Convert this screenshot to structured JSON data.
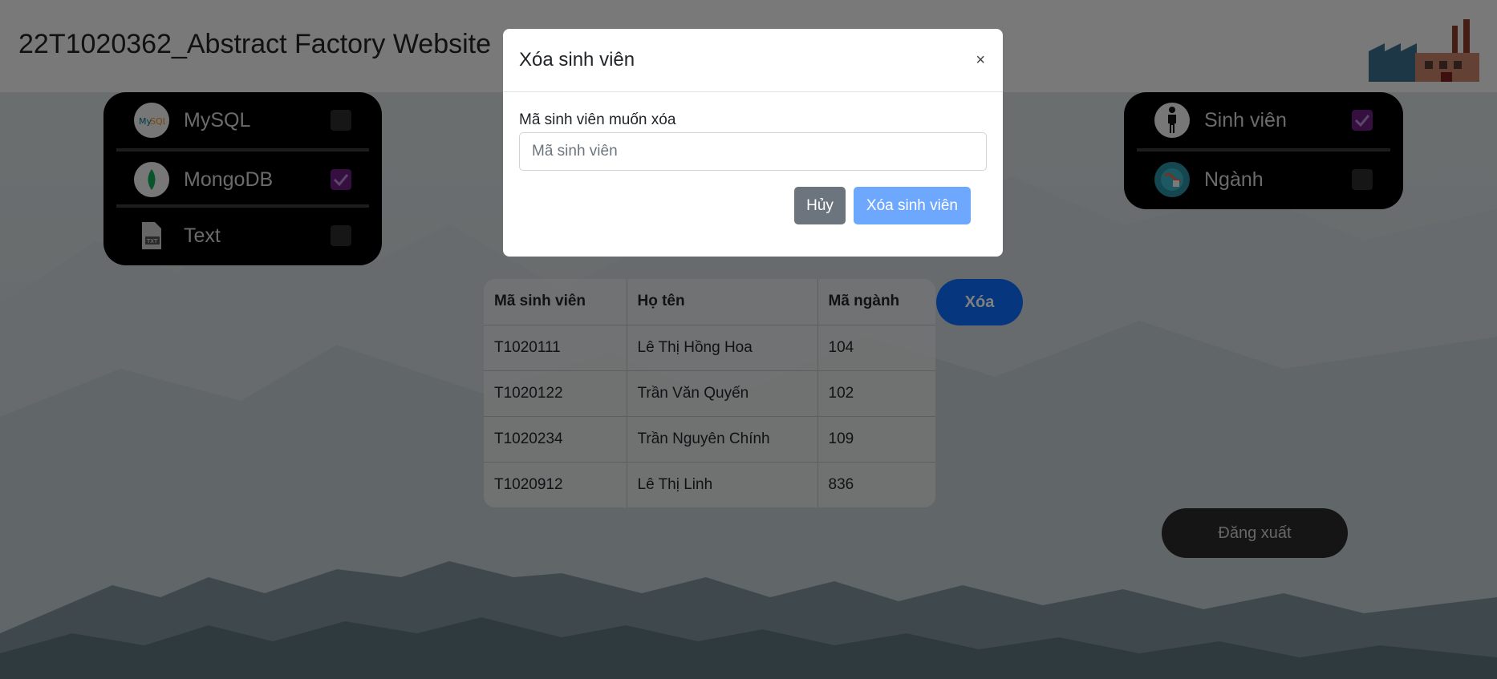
{
  "header": {
    "title": "22T1020362_Abstract Factory Website"
  },
  "db_panel": {
    "items": [
      {
        "label": "MySQL",
        "checked": false,
        "icon": "mysql-icon"
      },
      {
        "label": "MongoDB",
        "checked": true,
        "icon": "mongodb-icon"
      },
      {
        "label": "Text",
        "checked": false,
        "icon": "txt-file-icon"
      }
    ]
  },
  "entity_panel": {
    "items": [
      {
        "label": "Sinh viên",
        "checked": true,
        "icon": "person-icon"
      },
      {
        "label": "Ngành",
        "checked": false,
        "icon": "globe-icon"
      }
    ]
  },
  "table": {
    "headers": [
      "Mã sinh viên",
      "Họ tên",
      "Mã ngành"
    ],
    "rows": [
      [
        "T1020111",
        "Lê Thị Hồng Hoa",
        "104"
      ],
      [
        "T1020122",
        "Trần Văn Quyến",
        "102"
      ],
      [
        "T1020234",
        "Trần Nguyên Chính",
        "109"
      ],
      [
        "T1020912",
        "Lê Thị Linh",
        "836"
      ]
    ]
  },
  "actions": {
    "delete_label": "Xóa",
    "logout_label": "Đăng xuất"
  },
  "modal": {
    "title": "Xóa sinh viên",
    "close_symbol": "×",
    "field_label": "Mã sinh viên muốn xóa",
    "field_placeholder": "Mã sinh viên",
    "field_value": "",
    "cancel_label": "Hủy",
    "confirm_label": "Xóa sinh viên"
  },
  "colors": {
    "accent": "#0d6efd",
    "checked": "#6b1f80",
    "confirm_disabled": "#6ea8fe",
    "cancel": "#6c757d"
  }
}
